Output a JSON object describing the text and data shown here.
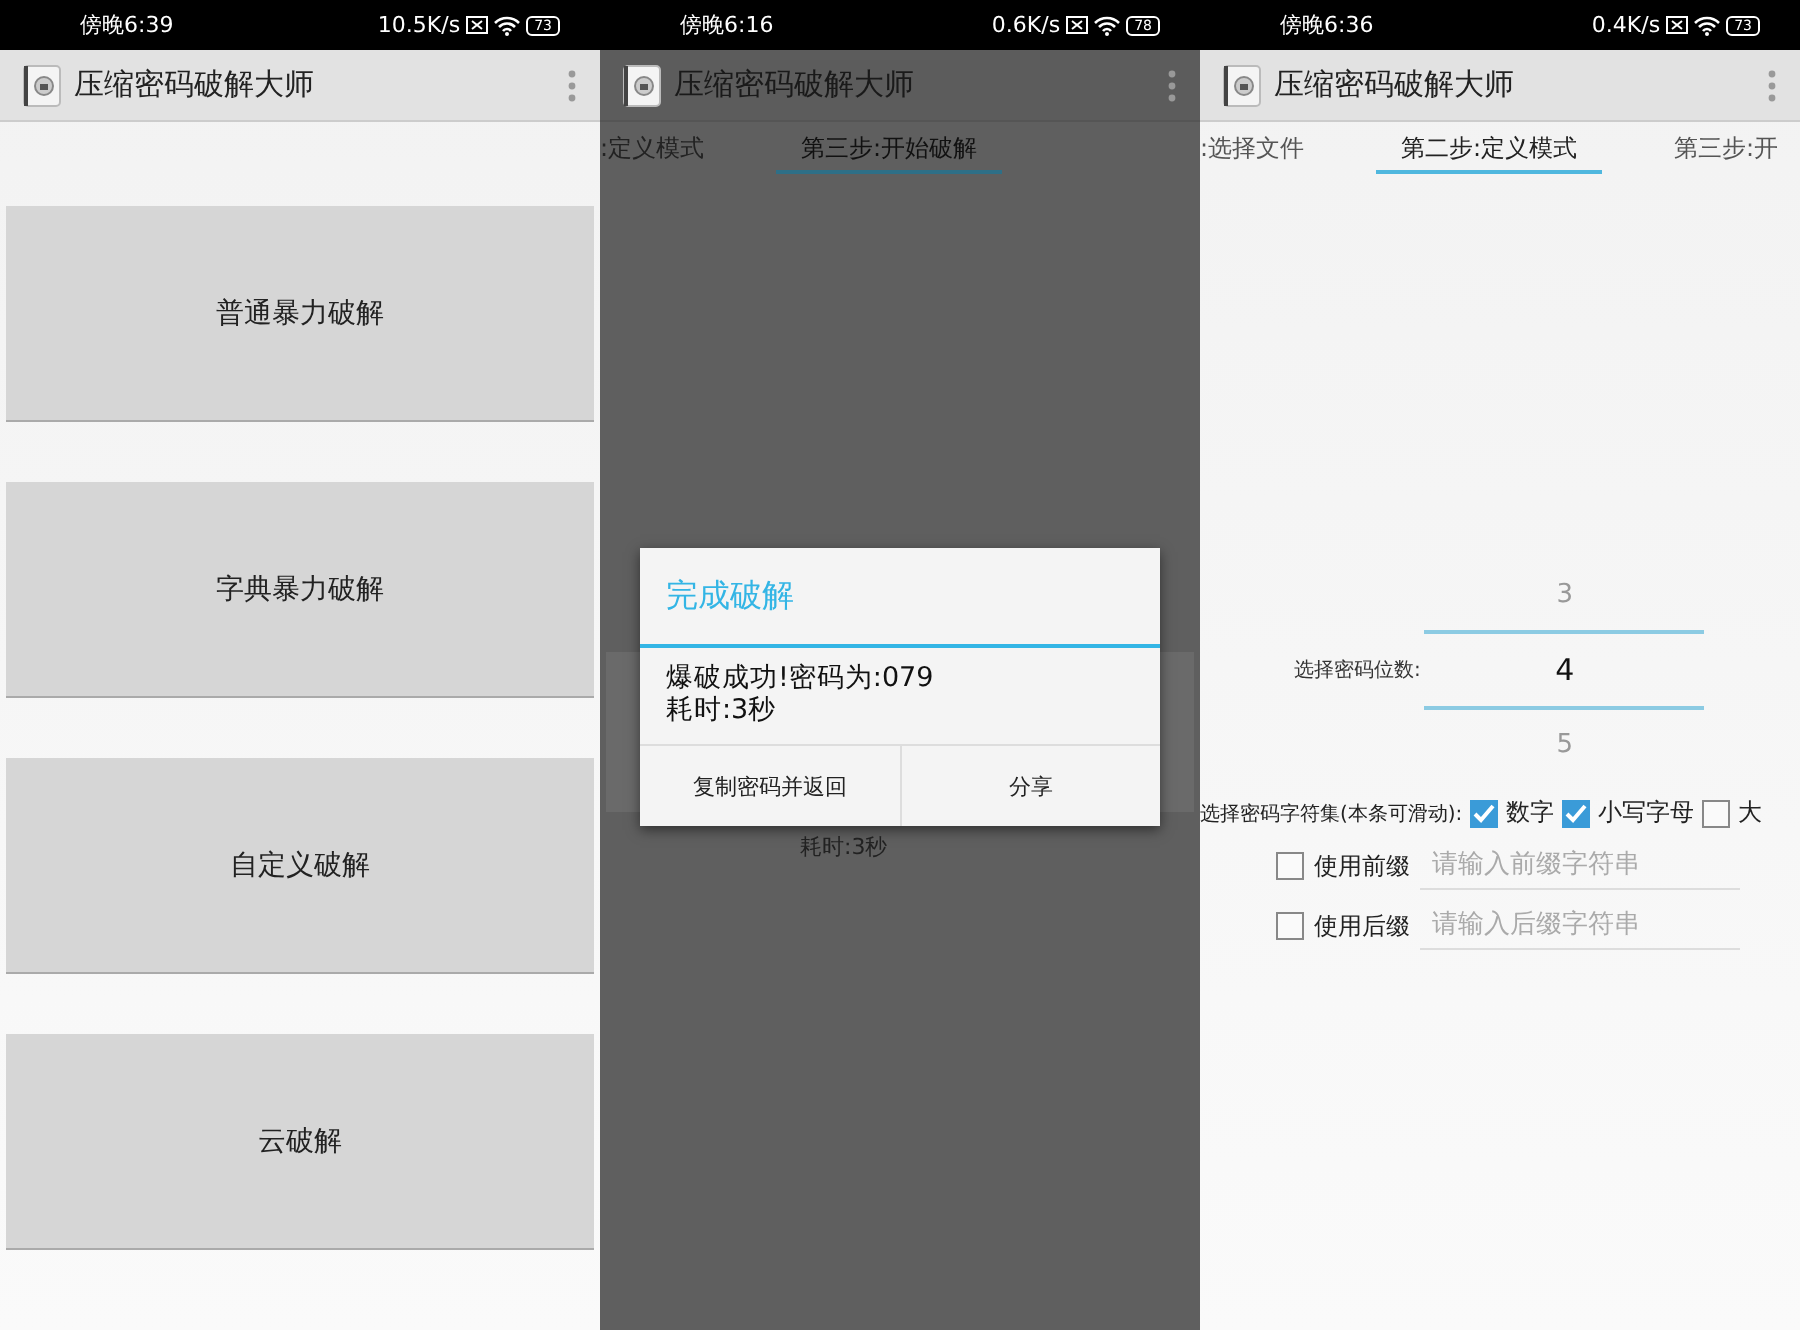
{
  "screens": [
    {
      "status_bar": {
        "time": "傍晚6:39",
        "speed": "10.5K/s",
        "battery": "73"
      },
      "app_bar": {
        "title": "压缩密码破解大师"
      },
      "buttons": [
        "普通暴力破解",
        "字典暴力破解",
        "自定义破解",
        "云破解"
      ]
    },
    {
      "status_bar": {
        "time": "傍晚6:16",
        "speed": "0.6K/s",
        "battery": "78"
      },
      "app_bar": {
        "title": "压缩密码破解大师"
      },
      "tabs": [
        {
          "label": ":定义模式",
          "selected": false
        },
        {
          "label": "第三步:开始破解",
          "selected": true
        }
      ],
      "background_text": "耗时:3秒",
      "dialog": {
        "title": "完成破解",
        "message": [
          "爆破成功!密码为:079",
          "耗时:3秒"
        ],
        "buttons": [
          "复制密码并返回",
          "分享"
        ]
      }
    },
    {
      "status_bar": {
        "time": "傍晚6:36",
        "speed": "0.4K/s",
        "battery": "73"
      },
      "app_bar": {
        "title": "压缩密码破解大师"
      },
      "tabs": [
        {
          "label": ":选择文件",
          "selected": false
        },
        {
          "label": "第二步:定义模式",
          "selected": true
        },
        {
          "label": "第三步:开",
          "selected": false
        }
      ],
      "picker": {
        "label": "选择密码位数:",
        "values": [
          {
            "value": "3",
            "selected": false
          },
          {
            "value": "4",
            "selected": true
          },
          {
            "value": "5",
            "selected": false
          }
        ]
      },
      "charset": {
        "label": "选择密码字符集(本条可滑动):",
        "options": [
          {
            "label": "数字",
            "checked": true
          },
          {
            "label": "小写字母",
            "checked": true
          },
          {
            "label": "大",
            "checked": false
          }
        ]
      },
      "affixes": [
        {
          "label": "使用前缀",
          "checked": false,
          "placeholder": "请输入前缀字符串"
        },
        {
          "label": "使用后缀",
          "checked": false,
          "placeholder": "请输入后缀字符串"
        }
      ]
    }
  ]
}
